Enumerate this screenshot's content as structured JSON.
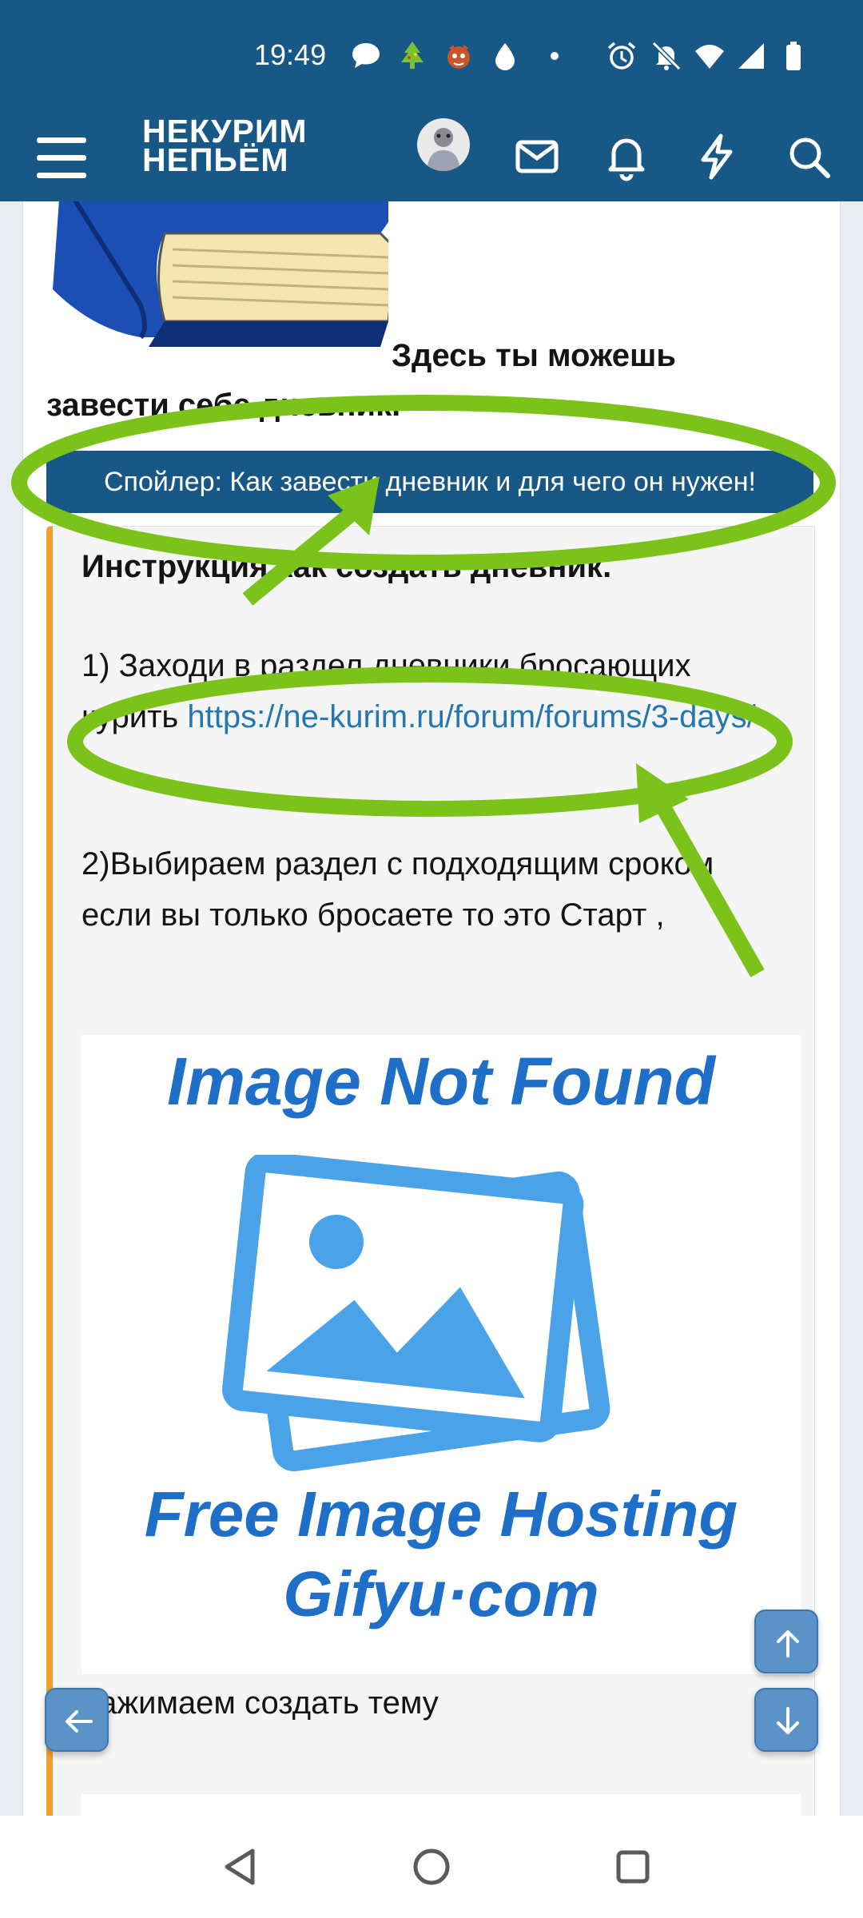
{
  "status_bar": {
    "time": "19:49",
    "icons": [
      "chat-bubble-icon",
      "christmas-tree-icon",
      "tiger-icon",
      "drop-icon",
      "dot-icon",
      "alarm-icon",
      "bell-off-icon",
      "wifi-icon",
      "signal-icon",
      "battery-icon"
    ]
  },
  "header": {
    "logo_line1": "НЕКУРИМ",
    "logo_line2": "НЕПЬЁМ",
    "icons": [
      "menu-icon",
      "avatar",
      "mail-icon",
      "notification-bell-icon",
      "lightning-icon",
      "search-icon"
    ],
    "color": "#185886"
  },
  "post": {
    "intro_bold_1": "Здесь ты можешь",
    "intro_bold_2": "завести себе дневник.",
    "spoiler_label": "Спойлер: Как завести дневник и для чего он нужен!",
    "instruction_title": "Инструкция как создать дневник.",
    "step1_text": "1) Заходи в раздел дневники бросающих курить ",
    "step1_link": "https://ne-kurim.ru/forum/forums/3-days/",
    "step2_text": "2)Выбираем раздел с подходящим сроком если вы только бросаете то это Старт ,",
    "image_text_top": "Image Not Found",
    "image_text_bottom_1": "Free Image Hosting",
    "image_text_bottom_2": "Gifyu·com",
    "step3_text": "нажимаем создать тему"
  },
  "colors": {
    "accent": "#185886",
    "link": "#2577b1",
    "spoiler_border": "#f0a031",
    "annotation_green": "#7bc31a",
    "placeholder_blue": "#4aa3e8"
  },
  "fab_buttons": [
    "arrow-up-icon",
    "arrow-down-icon",
    "arrow-left-icon"
  ],
  "system_nav": [
    "back-icon",
    "home-icon",
    "recents-icon"
  ]
}
